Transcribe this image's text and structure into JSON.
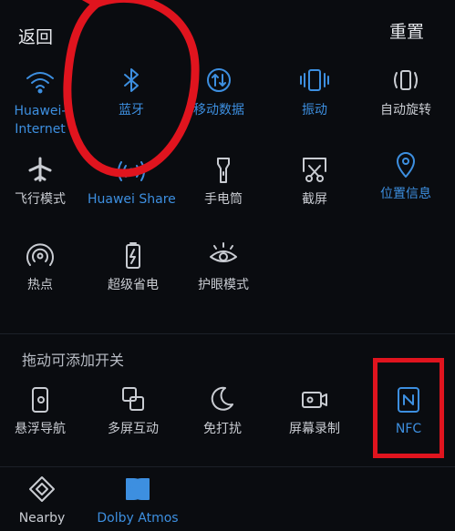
{
  "header": {
    "back_label": "返回",
    "reset_label": "重置"
  },
  "tiles_active": [
    {
      "id": "huawei-internet",
      "label": "Huawei-\nInternet",
      "icon": "wifi-icon",
      "on": true
    },
    {
      "id": "bluetooth",
      "label": "蓝牙",
      "icon": "bluetooth-icon",
      "on": true
    },
    {
      "id": "mobile-data",
      "label": "移动数据",
      "icon": "mobile-data-icon",
      "on": true
    },
    {
      "id": "vibrate",
      "label": "振动",
      "icon": "vibrate-icon",
      "on": true
    },
    {
      "id": "auto-rotate",
      "label": "自动旋转",
      "icon": "rotate-icon",
      "on": false
    },
    {
      "id": "airplane",
      "label": "飞行模式",
      "icon": "airplane-icon",
      "on": false
    },
    {
      "id": "huawei-share",
      "label": "Huawei Share",
      "icon": "share-signal-icon",
      "on": true
    },
    {
      "id": "flashlight",
      "label": "手电筒",
      "icon": "flashlight-icon",
      "on": false
    },
    {
      "id": "screenshot",
      "label": "截屏",
      "icon": "scissors-icon",
      "on": false
    },
    {
      "id": "location",
      "label": "位置信息",
      "icon": "location-pin-icon",
      "on": true
    },
    {
      "id": "hotspot",
      "label": "热点",
      "icon": "hotspot-icon",
      "on": false
    },
    {
      "id": "power-saver",
      "label": "超级省电",
      "icon": "battery-bolt-icon",
      "on": false
    },
    {
      "id": "eye-comfort",
      "label": "护眼模式",
      "icon": "eye-icon",
      "on": false
    }
  ],
  "section": {
    "drag_to_add_label": "拖动可添加开关"
  },
  "tiles_available": [
    {
      "id": "floating-nav",
      "label": "悬浮导航",
      "icon": "floating-nav-icon",
      "on": false
    },
    {
      "id": "multi-screen",
      "label": "多屏互动",
      "icon": "multi-screen-icon",
      "on": false
    },
    {
      "id": "do-not-disturb",
      "label": "免打扰",
      "icon": "moon-icon",
      "on": false
    },
    {
      "id": "screen-record",
      "label": "屏幕录制",
      "icon": "video-camera-icon",
      "on": false
    },
    {
      "id": "nfc",
      "label": "NFC",
      "icon": "nfc-icon",
      "on": true
    },
    {
      "id": "nearby",
      "label": "Nearby",
      "icon": "nearby-diamond-icon",
      "on": false
    },
    {
      "id": "dolby-atmos",
      "label": "Dolby Atmos",
      "icon": "dolby-icon",
      "on": true
    }
  ],
  "colors": {
    "accent": "#3d8fe0",
    "annotation_red": "#e0141e",
    "background": "#0a0c10",
    "text": "#c9ccd2"
  }
}
